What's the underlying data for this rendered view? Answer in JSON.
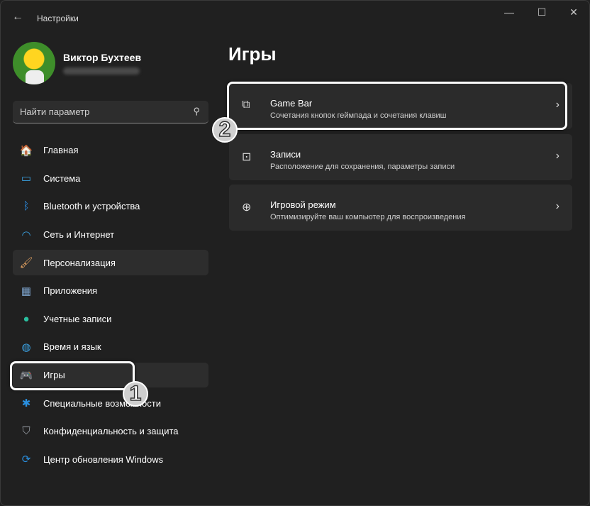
{
  "window": {
    "title": "Настройки",
    "controls": [
      "minimize",
      "maximize",
      "close"
    ]
  },
  "user": {
    "name": "Виктор Бухтеев"
  },
  "search": {
    "placeholder": "Найти параметр"
  },
  "sidebar": {
    "items": [
      {
        "label": "Главная",
        "icon": "home-icon",
        "glyph": "🏠"
      },
      {
        "label": "Система",
        "icon": "monitor-icon",
        "glyph": "▭"
      },
      {
        "label": "Bluetooth и устройства",
        "icon": "bluetooth-icon",
        "glyph": "ᛒ"
      },
      {
        "label": "Сеть и Интернет",
        "icon": "wifi-icon",
        "glyph": "◠"
      },
      {
        "label": "Персонализация",
        "icon": "brush-icon",
        "glyph": "🖌"
      },
      {
        "label": "Приложения",
        "icon": "apps-icon",
        "glyph": "▦"
      },
      {
        "label": "Учетные записи",
        "icon": "person-icon",
        "glyph": "●"
      },
      {
        "label": "Время и язык",
        "icon": "globe-icon",
        "glyph": "◍"
      },
      {
        "label": "Игры",
        "icon": "gamepad-icon",
        "glyph": "🎮"
      },
      {
        "label": "Специальные возможности",
        "icon": "accessibility-icon",
        "glyph": "✱"
      },
      {
        "label": "Конфиденциальность и защита",
        "icon": "shield-icon",
        "glyph": "⛉"
      },
      {
        "label": "Центр обновления Windows",
        "icon": "update-icon",
        "glyph": "⟳"
      }
    ]
  },
  "main": {
    "title": "Игры",
    "cards": [
      {
        "title": "Game Bar",
        "subtitle": "Сочетания кнопок геймпада и сочетания клавиш",
        "icon": "game-bar-icon",
        "glyph": "⧉"
      },
      {
        "title": "Записи",
        "subtitle": "Расположение для сохранения, параметры записи",
        "icon": "capture-icon",
        "glyph": "⊡"
      },
      {
        "title": "Игровой режим",
        "subtitle": "Оптимизируйте ваш компьютер для воспроизведения",
        "icon": "game-mode-icon",
        "glyph": "⊕"
      }
    ]
  },
  "annotations": {
    "step1": "1",
    "step2": "2"
  }
}
